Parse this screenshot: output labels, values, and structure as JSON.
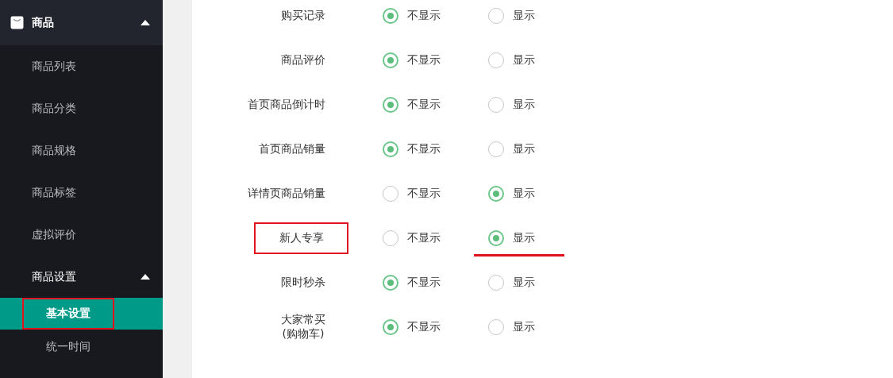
{
  "sidebar": {
    "section": {
      "label": "商品",
      "expanded": true
    },
    "items": [
      {
        "label": "商品列表",
        "selected": false
      },
      {
        "label": "商品分类",
        "selected": false
      },
      {
        "label": "商品规格",
        "selected": false
      },
      {
        "label": "商品标签",
        "selected": false
      },
      {
        "label": "虚拟评价",
        "selected": false
      },
      {
        "label": "商品设置",
        "expanded": true,
        "children": [
          {
            "label": "基本设置",
            "selected": true,
            "marked": true
          },
          {
            "label": "统一时间",
            "selected": false,
            "marked": false
          }
        ]
      }
    ]
  },
  "settings": [
    {
      "label": "购买记录",
      "marked": false,
      "options": [
        {
          "label": "不显示",
          "selected": true,
          "marked": false
        },
        {
          "label": "显示",
          "selected": false,
          "marked": false
        }
      ]
    },
    {
      "label": "商品评价",
      "marked": false,
      "options": [
        {
          "label": "不显示",
          "selected": true,
          "marked": false
        },
        {
          "label": "显示",
          "selected": false,
          "marked": false
        }
      ]
    },
    {
      "label": "首页商品倒计时",
      "marked": false,
      "options": [
        {
          "label": "不显示",
          "selected": true,
          "marked": false
        },
        {
          "label": "显示",
          "selected": false,
          "marked": false
        }
      ]
    },
    {
      "label": "首页商品销量",
      "marked": false,
      "options": [
        {
          "label": "不显示",
          "selected": true,
          "marked": false
        },
        {
          "label": "显示",
          "selected": false,
          "marked": false
        }
      ]
    },
    {
      "label": "详情页商品销量",
      "marked": false,
      "options": [
        {
          "label": "不显示",
          "selected": false,
          "marked": false
        },
        {
          "label": "显示",
          "selected": true,
          "marked": false
        }
      ]
    },
    {
      "label": "新人专享",
      "marked": true,
      "options": [
        {
          "label": "不显示",
          "selected": false,
          "marked": false
        },
        {
          "label": "显示",
          "selected": true,
          "marked": true
        }
      ]
    },
    {
      "label": "限时秒杀",
      "marked": false,
      "options": [
        {
          "label": "不显示",
          "selected": true,
          "marked": false
        },
        {
          "label": "显示",
          "selected": false,
          "marked": false
        }
      ]
    },
    {
      "label": "大家常买\n(购物车)",
      "marked": false,
      "options": [
        {
          "label": "不显示",
          "selected": true,
          "marked": false
        },
        {
          "label": "显示",
          "selected": false,
          "marked": false
        }
      ]
    }
  ]
}
